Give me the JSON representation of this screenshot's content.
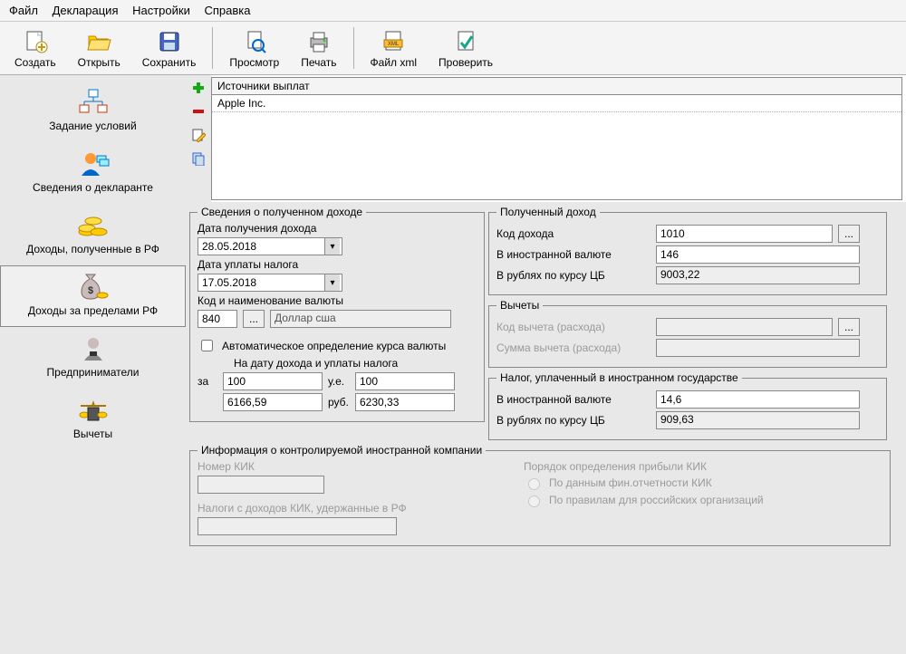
{
  "menu": {
    "file": "Файл",
    "decl": "Декларация",
    "settings": "Настройки",
    "help": "Справка"
  },
  "toolbar": {
    "create": "Создать",
    "open": "Открыть",
    "save": "Сохранить",
    "preview": "Просмотр",
    "print": "Печать",
    "xml": "Файл xml",
    "check": "Проверить"
  },
  "sidebar": {
    "conditions": "Задание условий",
    "declarant": "Сведения о декларанте",
    "income_rf": "Доходы, полученные в РФ",
    "income_abroad": "Доходы за пределами РФ",
    "entrepreneurs": "Предприниматели",
    "deductions": "Вычеты"
  },
  "sources": {
    "header": "Источники выплат",
    "rows": [
      "Apple Inc."
    ]
  },
  "income_info": {
    "legend": "Сведения о полученном доходе",
    "date_received_label": "Дата получения дохода",
    "date_received": "28.05.2018",
    "date_tax_label": "Дата уплаты налога",
    "date_tax": "17.05.2018",
    "currency_label": "Код и наименование валюты",
    "currency_code": "840",
    "currency_name": "Доллар сша",
    "auto_rate": "Автоматическое определение курса валюты",
    "rate_title": "На дату дохода и уплаты налога",
    "za": "за",
    "ue": "у.е.",
    "rub": "руб.",
    "per_qty1": "100",
    "per_qty2": "100",
    "rate1": "6166,59",
    "rate2": "6230,33"
  },
  "received": {
    "legend": "Полученный доход",
    "code_label": "Код дохода",
    "code": "1010",
    "foreign_label": "В иностранной валюте",
    "foreign": "146",
    "rub_label": "В рублях по курсу ЦБ",
    "rub": "9003,22"
  },
  "deduct": {
    "legend": "Вычеты",
    "code_label": "Код вычета (расхода)",
    "sum_label": "Сумма вычета (расхода)"
  },
  "tax_paid": {
    "legend": "Налог, уплаченный в иностранном государстве",
    "foreign_label": "В иностранной валюте",
    "foreign": "14,6",
    "rub_label": "В рублях по курсу ЦБ",
    "rub": "909,63"
  },
  "kik": {
    "legend": "Информация о контролируемой иностранной компании",
    "number_label": "Номер КИК",
    "taxes_label": "Налоги с доходов КИК, удержанные в РФ",
    "order_label": "Порядок определения прибыли КИК",
    "opt1": "По данным фин.отчетности КИК",
    "opt2": "По правилам для российских организаций"
  }
}
